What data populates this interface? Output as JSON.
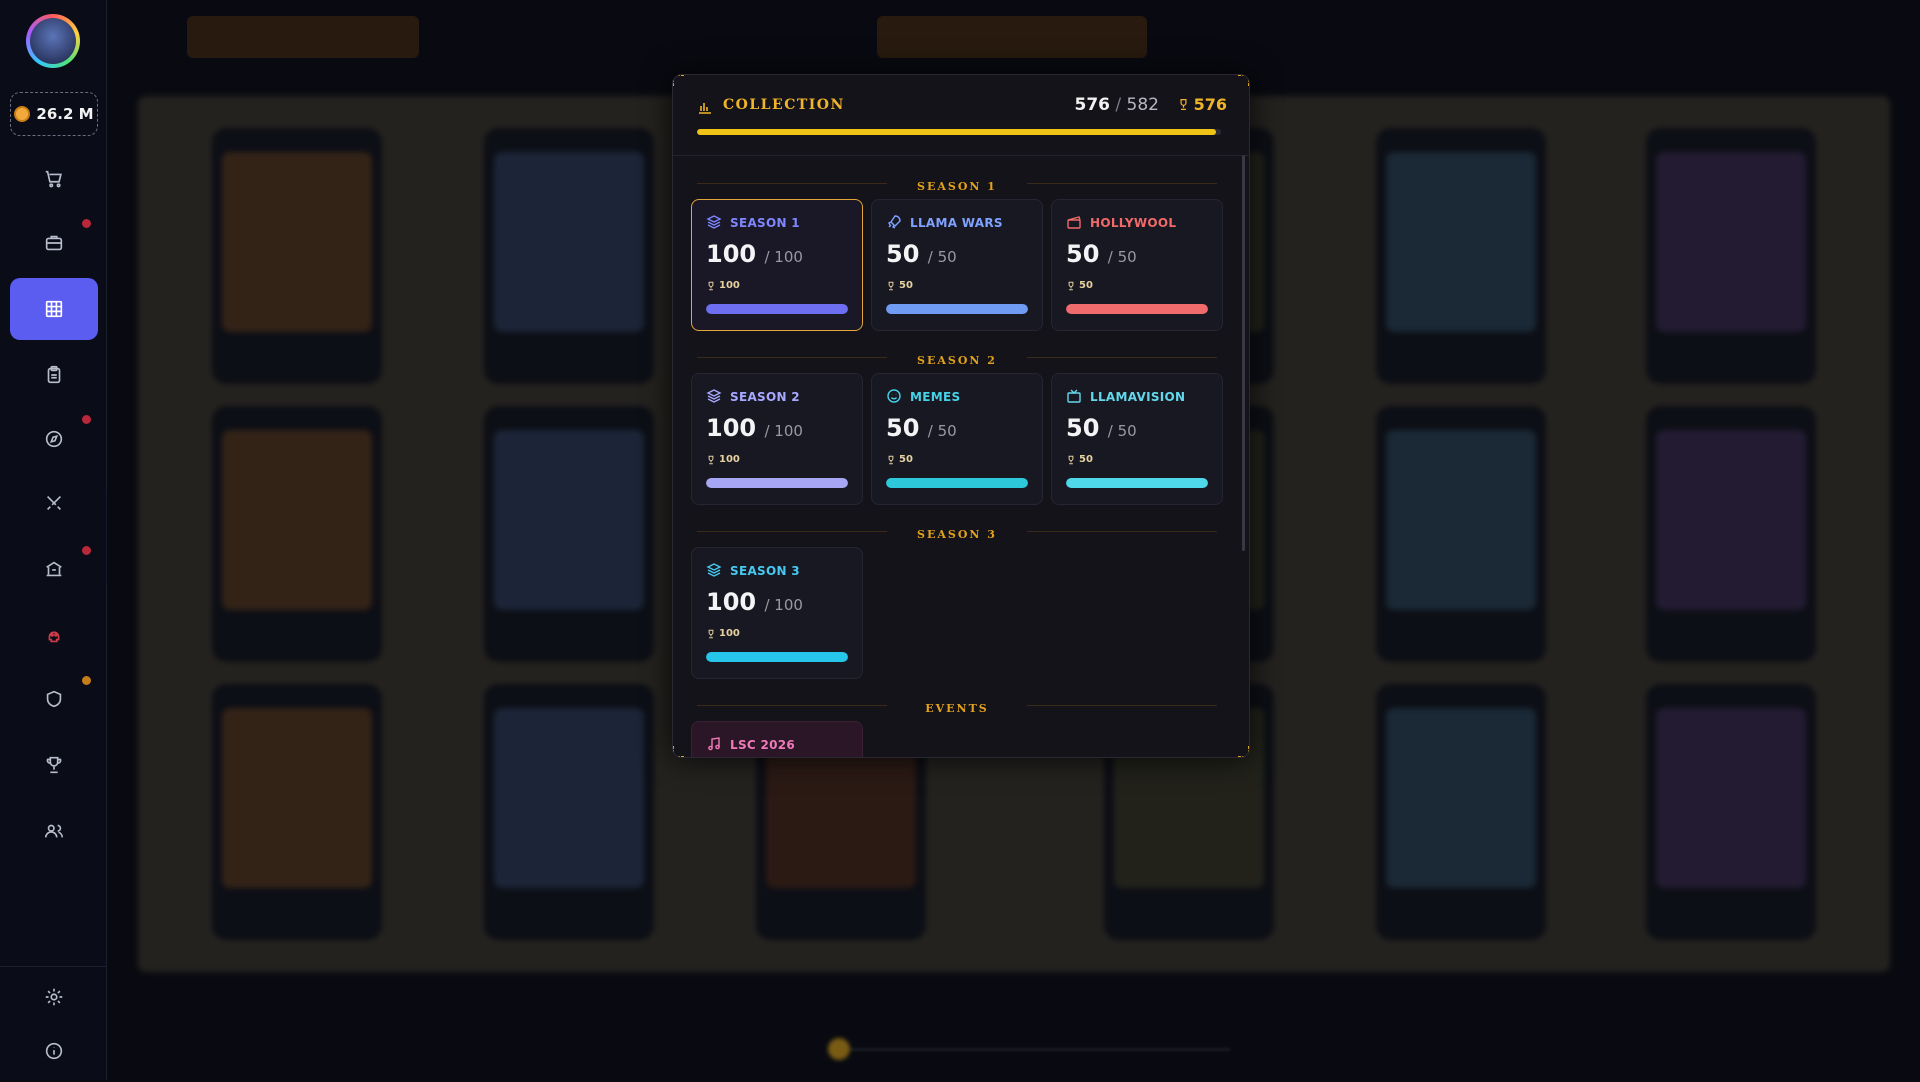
{
  "sidebar": {
    "coins": "26.2 M",
    "nav": [
      {
        "name": "cart-icon"
      },
      {
        "name": "briefcase-icon"
      },
      {
        "name": "grid-icon"
      },
      {
        "name": "clipboard-icon"
      },
      {
        "name": "compass-icon"
      },
      {
        "name": "swords-icon"
      },
      {
        "name": "bank-icon"
      },
      {
        "name": "skull-icon"
      },
      {
        "name": "shield-icon"
      },
      {
        "name": "trophy-icon"
      },
      {
        "name": "users-icon"
      }
    ]
  },
  "collection": {
    "title": "COLLECTION",
    "owned": "576",
    "total": "582",
    "trophies": "576",
    "progress": 0.99,
    "accent": "#f0c417"
  },
  "sections": [
    {
      "label": "SEASON 1"
    },
    {
      "label": "SEASON 2"
    },
    {
      "label": "SEASON 3"
    },
    {
      "label": "EVENTS"
    }
  ],
  "tiles": [
    {
      "name": "SEASON 1",
      "count": "100",
      "max": "/ 100",
      "trophy": "100",
      "color": "#7f86ff",
      "bar": "#6d6ff0",
      "icon": "layers-icon",
      "progress": 1
    },
    {
      "name": "LLAMA WARS",
      "count": "50",
      "max": "/ 50",
      "trophy": "50",
      "color": "#7fa2ff",
      "bar": "#6f9bf2",
      "icon": "rocket-icon",
      "progress": 1
    },
    {
      "name": "HOLLYWOOL",
      "count": "50",
      "max": "/ 50",
      "trophy": "50",
      "color": "#f06a6a",
      "bar": "#f06b6b",
      "icon": "clapper-icon",
      "progress": 1
    },
    {
      "name": "SEASON 2",
      "count": "100",
      "max": "/ 100",
      "trophy": "100",
      "color": "#a7a8ff",
      "bar": "#a6a6f5",
      "icon": "layers-icon",
      "progress": 1
    },
    {
      "name": "MEMES",
      "count": "50",
      "max": "/ 50",
      "trophy": "50",
      "color": "#46d2e6",
      "bar": "#2ec8db",
      "icon": "smile-icon",
      "progress": 1
    },
    {
      "name": "LLAMAVISION",
      "count": "50",
      "max": "/ 50",
      "trophy": "50",
      "color": "#63d8ec",
      "bar": "#4fd7ea",
      "icon": "tv-icon",
      "progress": 1
    },
    {
      "name": "SEASON 3",
      "count": "100",
      "max": "/ 100",
      "trophy": "100",
      "color": "#47c8f0",
      "bar": "#25c6ea",
      "icon": "layers-icon",
      "progress": 1
    },
    {
      "name": "LSC 2026",
      "count": "",
      "max": "",
      "trophy": "",
      "color": "#f07ab8",
      "bar": "#f07ab8",
      "icon": "music-icon",
      "progress": 1
    }
  ]
}
